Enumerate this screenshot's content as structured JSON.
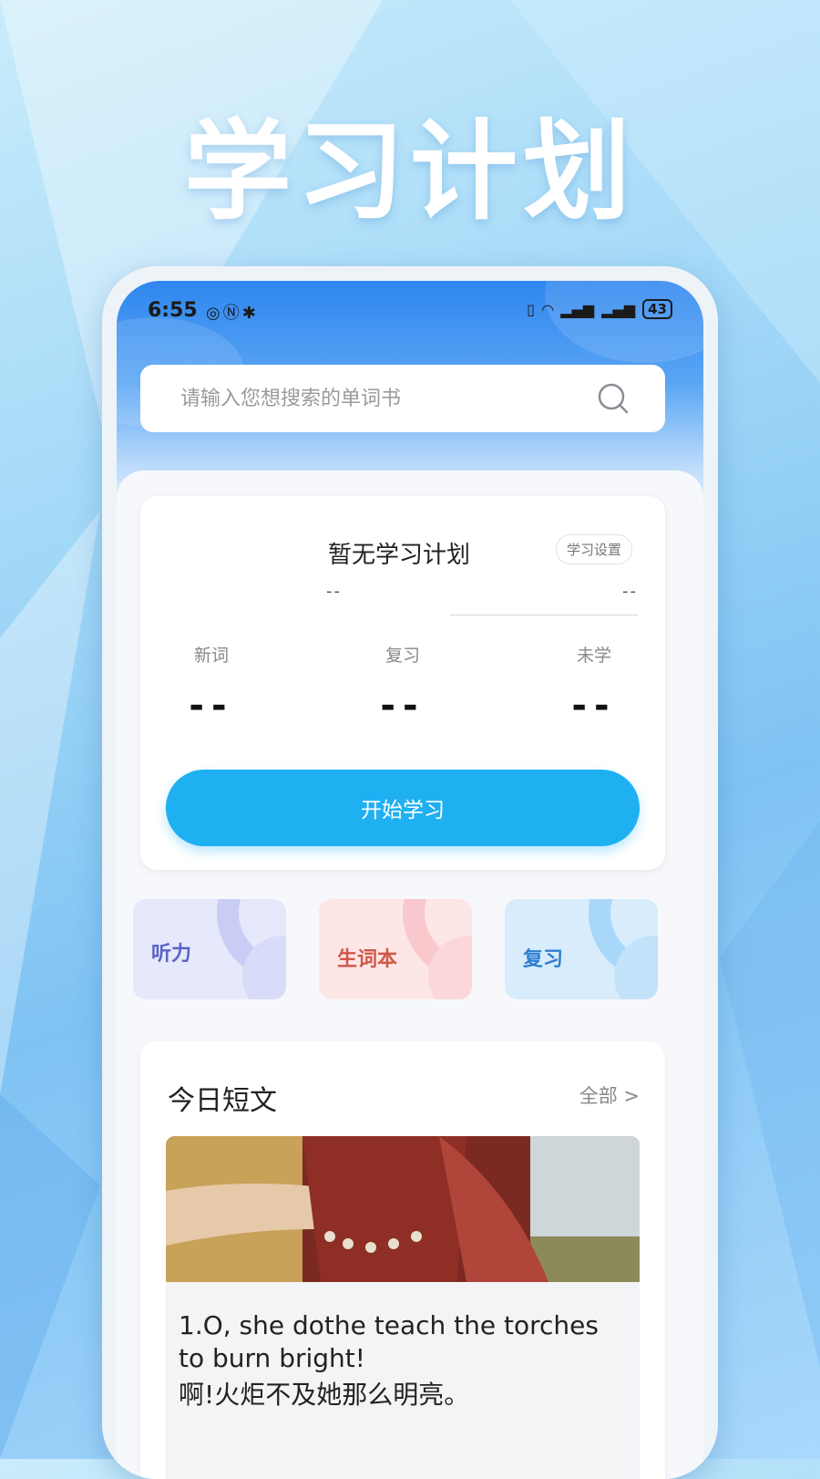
{
  "promo": {
    "title": "学习计划"
  },
  "status_bar": {
    "time": "6:55",
    "left_icons": [
      "nfc-icon",
      "n-icon",
      "bluetooth-icon"
    ],
    "battery": "43"
  },
  "search": {
    "placeholder": "请输入您想搜索的单词书"
  },
  "plan": {
    "title": "暂无学习计划",
    "settings_label": "学习设置",
    "sub_left": "--",
    "sub_right": "--",
    "stats": [
      {
        "label": "新词",
        "value": "--"
      },
      {
        "label": "复习",
        "value": "--"
      },
      {
        "label": "未学",
        "value": "--"
      }
    ],
    "start_label": "开始学习"
  },
  "tiles": [
    {
      "label": "听力",
      "color": "#5a63c8",
      "bg": "#e6e8fb",
      "arc": "#c9cdf6"
    },
    {
      "label": "生词本",
      "color": "#d0584a",
      "bg": "#fde6e6",
      "arc": "#f9c8cc"
    },
    {
      "label": "复习",
      "color": "#2f7fd0",
      "bg": "#d8ecfc",
      "arc": "#a9d7f9"
    }
  ],
  "article": {
    "heading": "今日短文",
    "all_label": "全部 >",
    "en": "1.O, she dothe teach the torches to burn bright!",
    "zh": "啊!火炬不及她那么明亮。"
  }
}
